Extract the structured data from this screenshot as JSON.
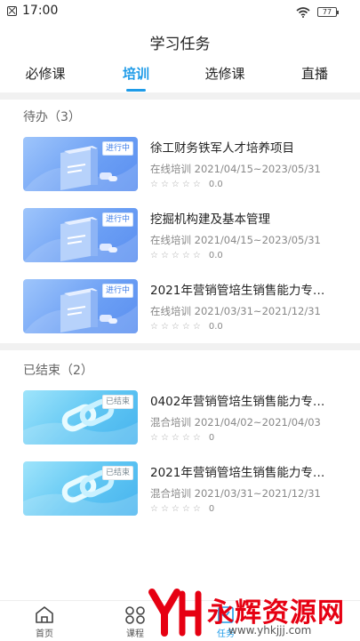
{
  "status_bar": {
    "time": "17:00",
    "battery": "77"
  },
  "header": {
    "title": "学习任务"
  },
  "tabs": [
    {
      "label": "必修课"
    },
    {
      "label": "培训"
    },
    {
      "label": "选修课"
    },
    {
      "label": "直播"
    }
  ],
  "sections": {
    "todo": {
      "title": "待办（3）",
      "items": [
        {
          "title": "徐工财务铁军人才培养项目",
          "meta": "在线培训 2021/04/15~2023/05/31",
          "stars": "☆☆☆☆☆",
          "score": "0.0",
          "badge": "进行中"
        },
        {
          "title": "挖掘机构建及基本管理",
          "meta": "在线培训 2021/04/15~2023/05/31",
          "stars": "☆☆☆☆☆",
          "score": "0.0",
          "badge": "进行中"
        },
        {
          "title": "2021年营销管培生销售能力专…",
          "meta": "在线培训 2021/03/31~2021/12/31",
          "stars": "☆☆☆☆☆",
          "score": "0.0",
          "badge": "进行中"
        }
      ]
    },
    "done": {
      "title": "已结束（2）",
      "items": [
        {
          "title": "0402年营销管培生销售能力专…",
          "meta": "混合培训 2021/04/02~2021/04/03",
          "stars": "☆☆☆☆☆",
          "score": "0",
          "badge": "已结束"
        },
        {
          "title": "2021年营销管培生销售能力专…",
          "meta": "混合培训 2021/03/31~2021/12/31",
          "stars": "☆☆☆☆☆",
          "score": "0",
          "badge": "已结束"
        }
      ]
    }
  },
  "bottom_nav": [
    {
      "label": "首页",
      "icon": "home-icon"
    },
    {
      "label": "课程",
      "icon": "course-icon"
    },
    {
      "label": "任务",
      "icon": "task-icon"
    }
  ],
  "watermark": {
    "text": "永辉资源网",
    "url": "www.yhkjjj.com"
  },
  "colors": {
    "accent": "#1e9be8",
    "brand_red": "#e60012"
  }
}
